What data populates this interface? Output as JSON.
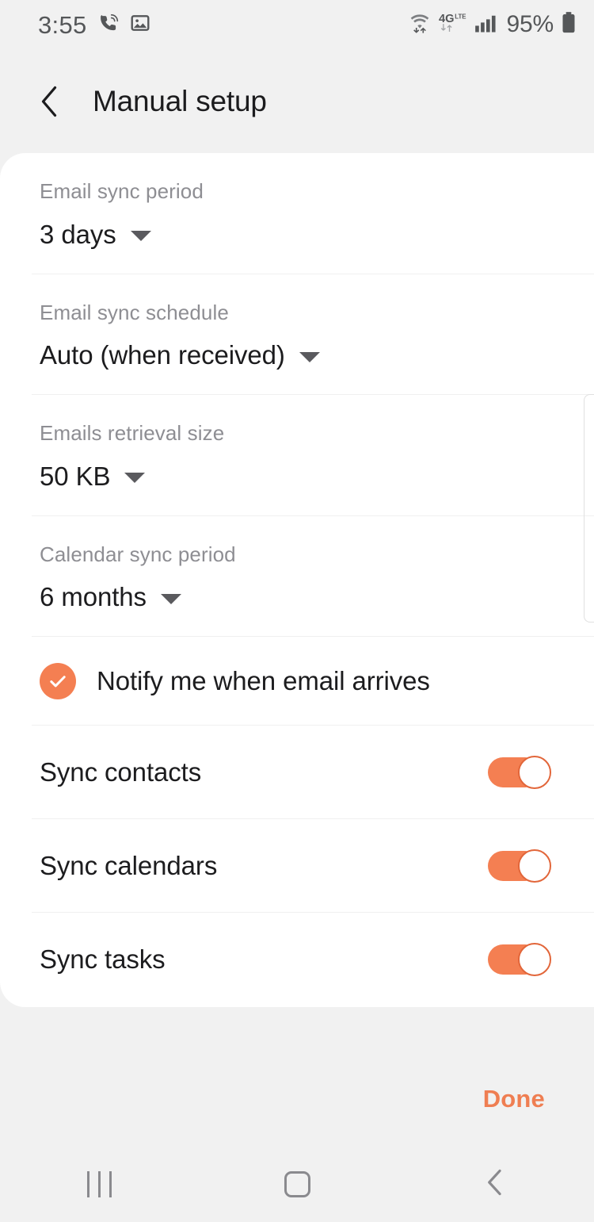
{
  "status_bar": {
    "time": "3:55",
    "battery_percent": "95%",
    "left_icons": [
      "wifi-calling-icon",
      "image-icon"
    ],
    "right_icons": [
      "wifi-icon",
      "4g-lte-icon",
      "signal-bars-icon",
      "battery-icon"
    ],
    "network_label": "4G",
    "network_sub_label": "LTE"
  },
  "app_bar": {
    "title": "Manual setup",
    "back_icon": "back-arrow-icon"
  },
  "settings": {
    "dropdowns": [
      {
        "label": "Email sync period",
        "value": "3 days"
      },
      {
        "label": "Email sync schedule",
        "value": "Auto (when received)"
      },
      {
        "label": "Emails retrieval size",
        "value": "50 KB"
      },
      {
        "label": "Calendar sync period",
        "value": "6 months"
      }
    ],
    "checkbox": {
      "label": "Notify me when email arrives",
      "checked": true
    },
    "toggles": [
      {
        "label": "Sync contacts",
        "on": true
      },
      {
        "label": "Sync calendars",
        "on": true
      },
      {
        "label": "Sync tasks",
        "on": true
      }
    ]
  },
  "footer": {
    "done_label": "Done"
  },
  "nav_bar": {
    "recents_icon": "recents-icon",
    "home_icon": "home-icon",
    "back_icon": "back-icon"
  },
  "colors": {
    "accent": "#f47f52",
    "done": "#ef7e52",
    "background": "#f1f1f1",
    "card": "#ffffff",
    "label_grey": "#8e8e93",
    "text": "#1c1c1e"
  }
}
